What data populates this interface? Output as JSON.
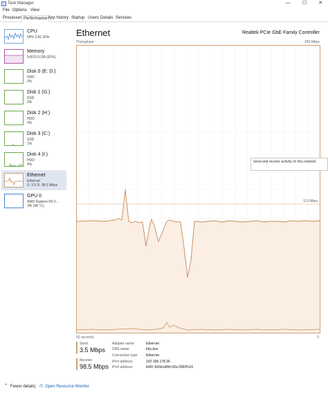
{
  "window": {
    "title": "Task Manager",
    "controls": [
      "—",
      "☐",
      "✕"
    ]
  },
  "menu": [
    "File",
    "Options",
    "View"
  ],
  "tabs": [
    "Processes",
    "Performance",
    "App history",
    "Startup",
    "Users",
    "Details",
    "Services"
  ],
  "active_tab": "Performance",
  "sidebar": {
    "items": [
      {
        "name": "CPU",
        "l1": "64%  3.81 GHz",
        "l2": ""
      },
      {
        "name": "Memory",
        "l1": "9.8/15.9 GB (62%)",
        "l2": ""
      },
      {
        "name": "Disk 0 (E: D:)",
        "l1": "HDD",
        "l2": "0%"
      },
      {
        "name": "Disk 1 (G:)",
        "l1": "SSD",
        "l2": "0%"
      },
      {
        "name": "Disk 2 (H:)",
        "l1": "HDD",
        "l2": "0%"
      },
      {
        "name": "Disk 3 (C:)",
        "l1": "SSD",
        "l2": "1%"
      },
      {
        "name": "Disk 4 (I:)",
        "l1": "HDD",
        "l2": "4%"
      },
      {
        "name": "Ethernet",
        "l1": "Ethernet",
        "l2": "S: 3.5  R: 98.5 Mbps"
      },
      {
        "name": "GPU 0",
        "l1": "AMD Radeon R9 2...",
        "l2": "3% (48 °C)"
      }
    ]
  },
  "main": {
    "title": "Ethernet",
    "adapter": "Realtek PCIe GbE Family Controller",
    "chart_label": "Throughput",
    "max_label": "250 Mbps",
    "mid_label": "113 Mbps",
    "x_left": "60 seconds",
    "x_right": "0",
    "tooltip": "Send and receive activity on this network"
  },
  "stats": {
    "send_label": "Send",
    "send_value": "3.5 Mbps",
    "receive_label": "Receive",
    "receive_value": "98.5 Mbps"
  },
  "details": [
    {
      "key": "Adapter name:",
      "value": "Ethernet"
    },
    {
      "key": "DNS name:",
      "value": "fritz.box"
    },
    {
      "key": "Connection type:",
      "value": "Ethernet"
    },
    {
      "key": "IPv4 address:",
      "value": "192.168.178.36"
    },
    {
      "key": "IPv6 address:",
      "value": "fe80::943d:e8bf:cf2e:2069%16"
    }
  ],
  "footer": {
    "fewer_details": "Fewer details",
    "open_monitor": "Open Resource Monitor"
  },
  "colors": {
    "accent": "#c9a07a",
    "chart_fill": "#fbeee3",
    "chart_line": "#c08a5a"
  }
}
